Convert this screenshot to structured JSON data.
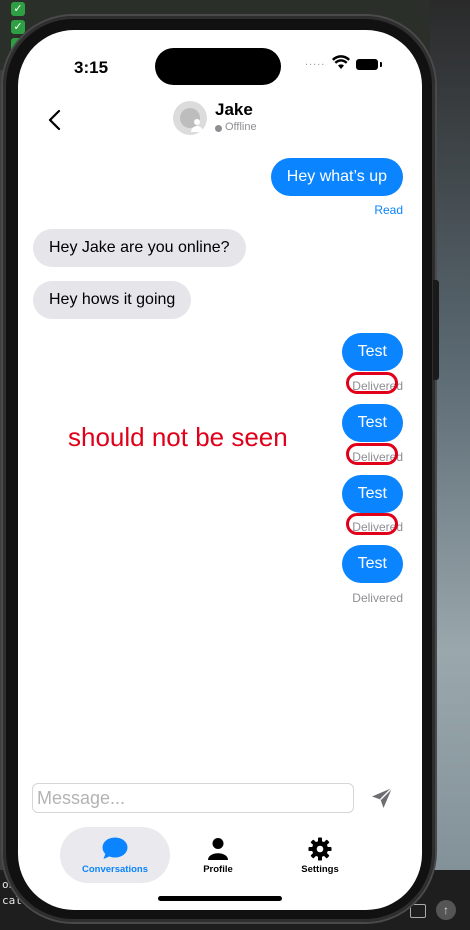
{
  "background": {
    "terminal_lines": [
      "onnect",
      "cal endpoint"
    ]
  },
  "status_bar": {
    "time": "3:15",
    "signal": "....."
  },
  "header": {
    "contact_name": "Jake",
    "contact_status": "Offline"
  },
  "messages": [
    {
      "text": "Hey what’s up",
      "direction": "outgoing",
      "receipt": "Read"
    },
    {
      "text": "Hey Jake are you online?",
      "direction": "incoming"
    },
    {
      "text": "Hey hows it going",
      "direction": "incoming"
    },
    {
      "text": "Test",
      "direction": "outgoing",
      "receipt": "Delivered"
    },
    {
      "text": "Test",
      "direction": "outgoing",
      "receipt": "Delivered"
    },
    {
      "text": "Test",
      "direction": "outgoing",
      "receipt": "Delivered"
    },
    {
      "text": "Test",
      "direction": "outgoing",
      "receipt": "Delivered"
    }
  ],
  "annotation": {
    "text": "should not be seen",
    "color": "#e0001a"
  },
  "composer": {
    "placeholder": "Message...",
    "send_icon": "paper-plane-icon"
  },
  "tabs": [
    {
      "label": "Conversations",
      "icon": "chat-bubble-icon",
      "active": true
    },
    {
      "label": "Profile",
      "icon": "person-icon",
      "active": false
    },
    {
      "label": "Settings",
      "icon": "gear-icon",
      "active": false
    }
  ],
  "colors": {
    "accent": "#0a84ff",
    "incoming_bubble": "#e5e5ea",
    "status_gray": "#8e8e93"
  }
}
